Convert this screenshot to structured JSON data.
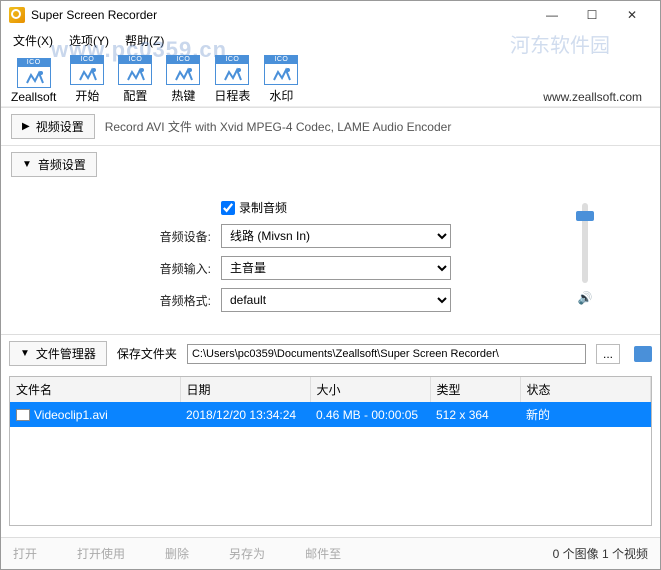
{
  "window": {
    "title": "Super Screen Recorder"
  },
  "menu": {
    "file": "文件(X)",
    "option": "选项(Y)",
    "help": "帮助(Z)"
  },
  "watermark": {
    "main": "www.pc0359.cn",
    "side": "河东软件园"
  },
  "toolbar": {
    "items": [
      {
        "label": "Zeallsoft"
      },
      {
        "label": "开始"
      },
      {
        "label": "配置"
      },
      {
        "label": "热键"
      },
      {
        "label": "日程表"
      },
      {
        "label": "水印"
      }
    ],
    "ico_badge": "ICO",
    "website": "www.zeallsoft.com"
  },
  "video": {
    "header": "视频设置",
    "desc": "Record AVI 文件 with Xvid MPEG-4 Codec, LAME Audio Encoder"
  },
  "audio": {
    "header": "音频设置",
    "record_label": "录制音频",
    "record_checked": true,
    "device_label": "音频设备:",
    "device_value": "线路 (Mivsn In)",
    "input_label": "音频输入:",
    "input_value": "主音量",
    "format_label": "音频格式:",
    "format_value": "default"
  },
  "files": {
    "header": "文件管理器",
    "save_label": "保存文件夹",
    "path": "C:\\Users\\pc0359\\Documents\\Zeallsoft\\Super Screen Recorder\\",
    "browse": "...",
    "columns": {
      "name": "文件名",
      "date": "日期",
      "size": "大小",
      "type": "类型",
      "state": "状态"
    },
    "rows": [
      {
        "name": "Videoclip1.avi",
        "date": "2018/12/20 13:34:24",
        "size": "0.46 MB - 00:00:05",
        "type": "512 x 364",
        "state": "新的"
      }
    ]
  },
  "bottom": {
    "open": "打开",
    "openuse": "打开使用",
    "delete": "删除",
    "saveas": "另存为",
    "mail": "邮件至",
    "status": "0 个图像 1 个视频"
  }
}
